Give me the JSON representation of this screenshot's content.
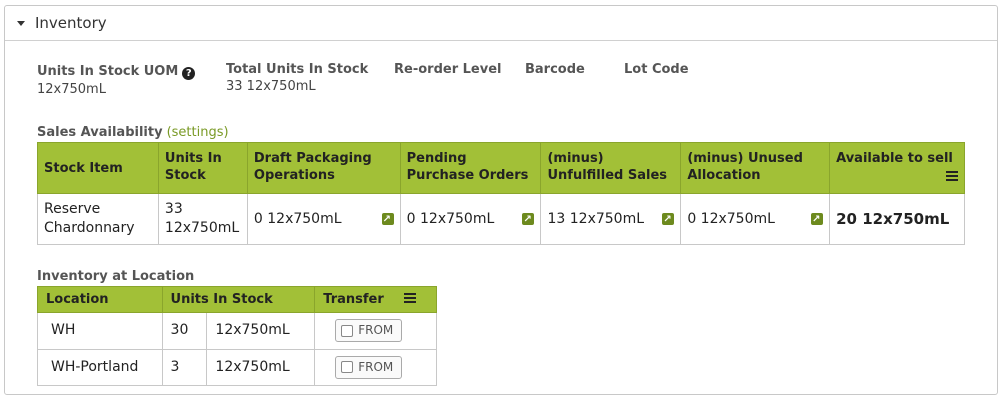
{
  "panel": {
    "title": "Inventory"
  },
  "fields": {
    "units_in_stock_uom": {
      "label": "Units In Stock UOM",
      "value": "12x750mL"
    },
    "total_units_in_stock": {
      "label": "Total Units In Stock",
      "value": "33 12x750mL"
    },
    "reorder_level": {
      "label": "Re-order Level"
    },
    "barcode": {
      "label": "Barcode"
    },
    "lot_code": {
      "label": "Lot Code"
    }
  },
  "sales": {
    "title": "Sales Availability",
    "settings_link": "(settings)",
    "headers": [
      "Stock Item",
      "Units In Stock",
      "Draft Packaging Operations",
      "Pending Purchase Orders",
      "(minus) Unfulfilled Sales",
      "(minus) Unused Allocation",
      "Available to sell"
    ],
    "row": {
      "stock_item": "Reserve Chardonnary",
      "units_in_stock": "33 12x750mL",
      "draft_packaging": "0 12x750mL",
      "pending_po": "0 12x750mL",
      "unfulfilled_sales": "13 12x750mL",
      "unused_allocation": "0 12x750mL",
      "available": "20 12x750mL"
    }
  },
  "location": {
    "title": "Inventory at Location",
    "headers": [
      "Location",
      "Units In Stock",
      "Transfer"
    ],
    "rows": [
      {
        "location": "WH",
        "qty": "30",
        "uom": "12x750mL",
        "button": "FROM"
      },
      {
        "location": "WH-Portland",
        "qty": "3",
        "uom": "12x750mL",
        "button": "FROM"
      }
    ]
  },
  "colors": {
    "header_green": "#a2c037",
    "link_green": "#7a9a26",
    "icon_green": "#6d8a1e"
  }
}
